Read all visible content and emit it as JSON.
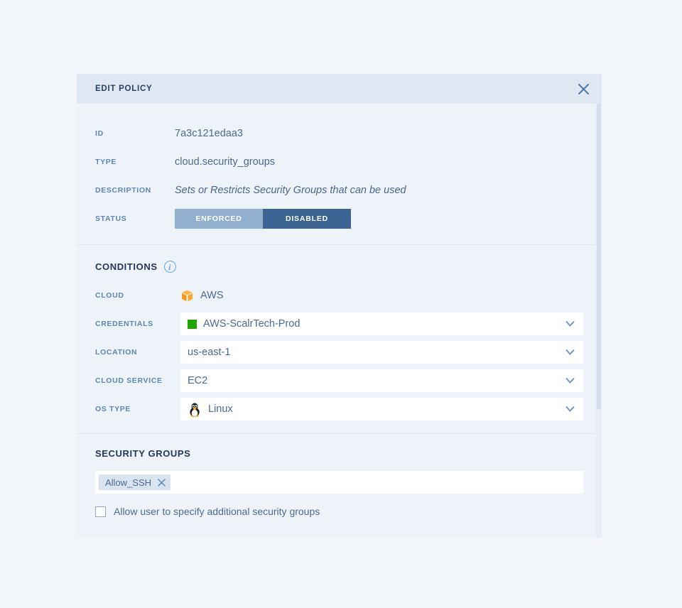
{
  "window": {
    "background_color": "#f2f5fa",
    "panel_background": "#eef3fa"
  },
  "header": {
    "title": "EDIT POLICY",
    "header_background": "#dfe8f2",
    "close_icon": "close-icon"
  },
  "details": {
    "rows": [
      {
        "label": "ID",
        "value": "7a3c121edaa3",
        "italic": false
      },
      {
        "label": "TYPE",
        "value": "cloud.security_groups",
        "italic": false
      },
      {
        "label": "DESCRIPTION",
        "value": "Sets or Restricts Security Groups that can be used",
        "italic": true
      }
    ],
    "status": {
      "label": "STATUS",
      "options": [
        {
          "text": "ENFORCED",
          "selected": false,
          "color": "#91b0cd"
        },
        {
          "text": "DISABLED",
          "selected": true,
          "color": "#3c6493"
        }
      ]
    }
  },
  "conditions": {
    "heading": "CONDITIONS",
    "info_icon": "info-icon",
    "info_icon_glyph": "i",
    "rows": [
      {
        "label": "CLOUD",
        "value": "AWS",
        "control": "static",
        "icon": "aws-cube-icon",
        "icon_color": "#f9a52b"
      },
      {
        "label": "CREDENTIALS",
        "value": "AWS-ScalrTech-Prod",
        "control": "dropdown",
        "icon": "green-status-square-icon",
        "icon_color": "#1da600"
      },
      {
        "label": "LOCATION",
        "value": "us-east-1",
        "control": "dropdown",
        "icon": null
      },
      {
        "label": "CLOUD SERVICE",
        "value": "EC2",
        "control": "dropdown",
        "icon": null
      },
      {
        "label": "OS TYPE",
        "value": "Linux",
        "control": "dropdown",
        "icon": "linux-penguin-icon"
      }
    ]
  },
  "security_groups": {
    "heading": "SECURITY GROUPS",
    "tags": [
      {
        "label": "Allow_SSH",
        "remove_icon": "remove-tag-icon"
      }
    ],
    "checkbox": {
      "label": "Allow user to specify additional security groups",
      "checked": false
    }
  },
  "scrollbar": {
    "track_color": "#e6edf6",
    "thumb_color": "#d3dfec"
  }
}
